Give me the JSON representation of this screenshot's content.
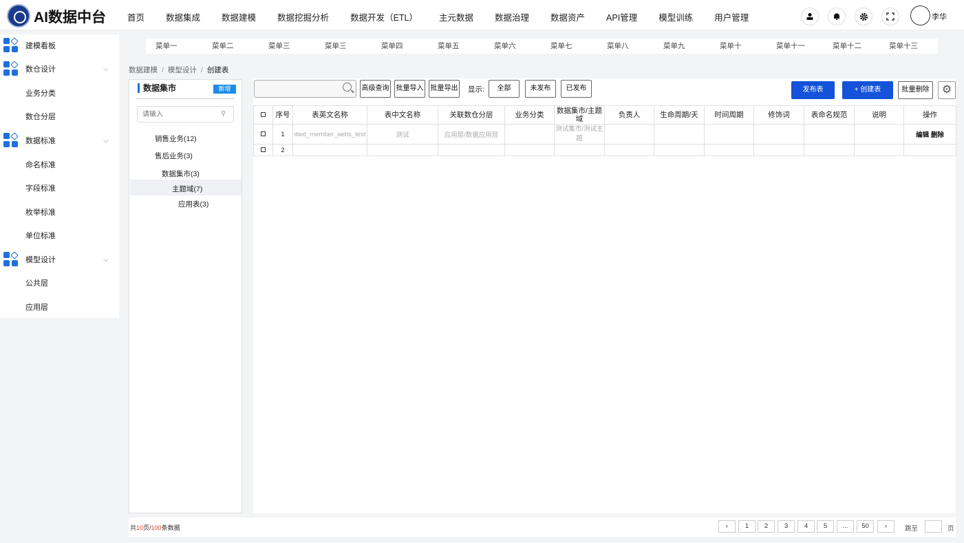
{
  "app": {
    "title": "AI数据中台"
  },
  "nav": [
    "首页",
    "数据集成",
    "数据建模",
    "数据挖掘分析",
    "数据开发（ETL）",
    "主元数据",
    "数据治理",
    "数据资产",
    "API管理",
    "模型训练",
    "用户管理"
  ],
  "user": {
    "name": "李华"
  },
  "sidebar": {
    "items": [
      {
        "label": "建模看板",
        "icon": "grid-icon"
      },
      {
        "label": "数仓设计",
        "icon": "grid-icon",
        "expand": "⌵"
      },
      {
        "label": "业务分类"
      },
      {
        "label": "数仓分层"
      },
      {
        "label": "数据标准",
        "icon": "grid-icon",
        "expand": "⌵"
      },
      {
        "label": "命名标准"
      },
      {
        "label": "字段标准"
      },
      {
        "label": "枚举标准"
      },
      {
        "label": "单位标准"
      },
      {
        "label": "模型设计",
        "icon": "grid-icon",
        "expand": "⌵"
      },
      {
        "label": "公共层"
      },
      {
        "label": "应用层"
      }
    ]
  },
  "menubar": [
    "菜单一",
    "菜单二",
    "菜单三",
    "菜单三",
    "菜单四",
    "菜单五",
    "菜单六",
    "菜单七",
    "菜单八",
    "菜单九",
    "菜单十",
    "菜单十一",
    "菜单十二",
    "菜单十三"
  ],
  "breadcrumb": [
    "数据建模",
    "模型设计",
    "创建表"
  ],
  "tree": {
    "title": "数据集市",
    "add_label": "新增",
    "search_placeholder": "请输入",
    "nodes": [
      "销售业务(12)",
      "售后业务(3)",
      "数据集市(3)",
      "主题域(7)",
      "应用表(3)"
    ]
  },
  "toolbar": {
    "advanced": "高级查询",
    "import": "批量导入",
    "export": "批量导出",
    "show_label": "显示:",
    "filter_all": "全部",
    "filter_unpublished": "未发布",
    "filter_published": "已发布",
    "publish": "发布表",
    "create": "+ 创建表",
    "batch_delete": "批量删除"
  },
  "table": {
    "headers": [
      "□",
      "序号",
      "表英文名称",
      "表中文名称",
      "关联数仓分层",
      "业务分类",
      "数据集市/主题域",
      "负责人",
      "生命周期/天",
      "时间周期",
      "修饰词",
      "表命名规范",
      "说明",
      "操作"
    ],
    "rows": [
      {
        "no": "1",
        "en": "dwd_member_aebs_test",
        "cn": "测试",
        "layer": "应用层/数据应用层",
        "biz": "",
        "mart": "测试集市/测试主题",
        "owner": "",
        "life": "",
        "period": "",
        "modifier": "",
        "naming": "",
        "desc": "",
        "op_edit": "编辑",
        "op_delete": "删除"
      },
      {
        "no": "2",
        "en": "",
        "cn": "",
        "layer": "",
        "biz": "",
        "mart": "",
        "owner": "",
        "life": "",
        "period": "",
        "modifier": "",
        "naming": "",
        "desc": "",
        "op_edit": "",
        "op_delete": ""
      }
    ]
  },
  "pagination": {
    "total_prefix": "共",
    "total_pages": "10",
    "total_mid": "页/",
    "total_records": "100",
    "total_suffix": "条数据",
    "prev": "‹",
    "pages": [
      "1",
      "2",
      "3",
      "4",
      "5",
      "...",
      "50"
    ],
    "next": "›",
    "jump_label": "跳至",
    "page_label": "页"
  },
  "colors": {
    "primary": "#1352d9",
    "accent": "#1e6fe0",
    "highlight": "#e0382c"
  }
}
